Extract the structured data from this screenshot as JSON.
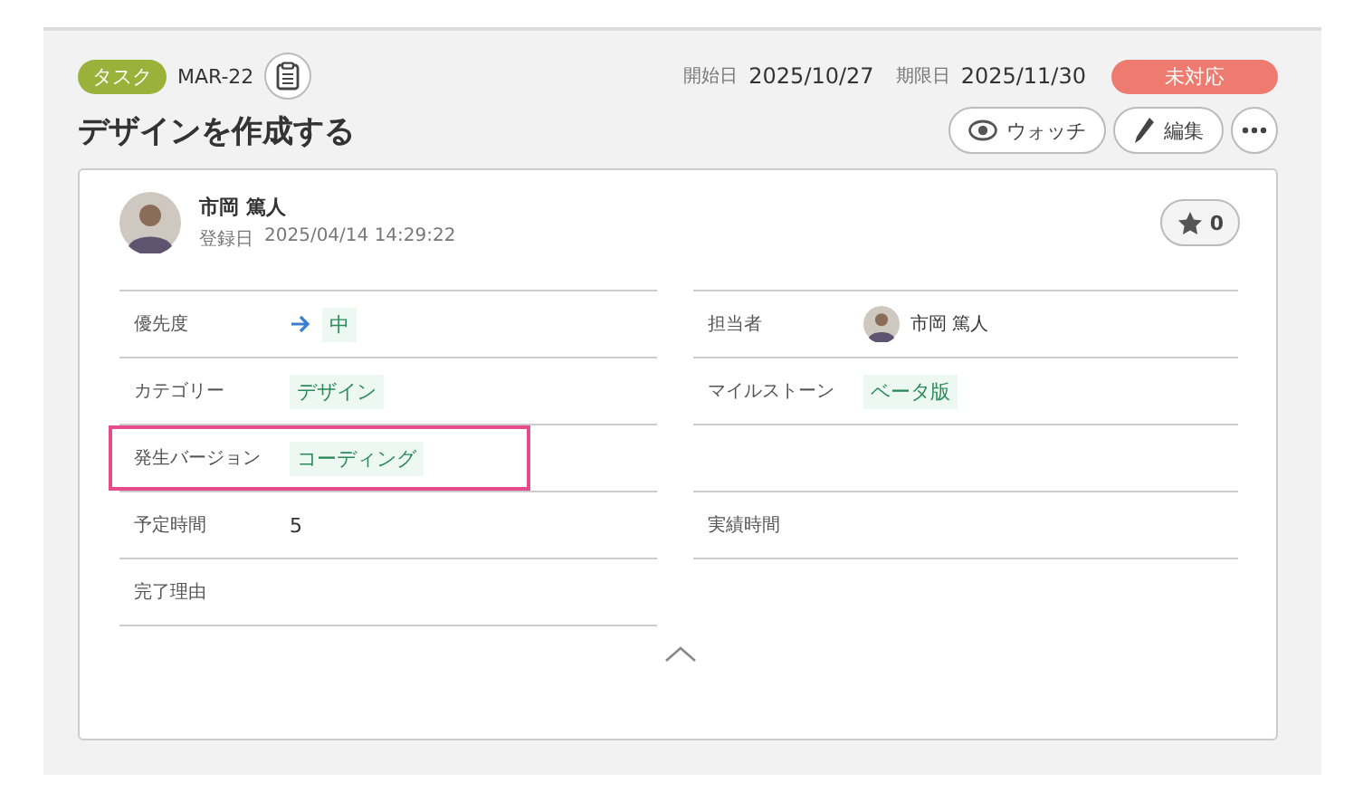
{
  "header": {
    "type_badge": "タスク",
    "key": "MAR-22",
    "start_label": "開始日",
    "start_date": "2025/10/27",
    "due_label": "期限日",
    "due_date": "2025/11/30",
    "status": "未対応",
    "title": "デザインを作成する",
    "buttons": [
      {
        "kind": "watch",
        "label": "ウォッチ"
      },
      {
        "kind": "edit",
        "label": "編集"
      },
      {
        "kind": "more"
      }
    ]
  },
  "author": {
    "name": "市岡 篤人",
    "registered_label": "登録日",
    "registered": "2025/04/14 14:29:22",
    "stars_count": "0"
  },
  "rows": [
    {
      "left": {
        "kind": "priority",
        "label": "優先度",
        "value": "中",
        "highlighted": false
      },
      "right": {
        "kind": "user",
        "label": "担当者",
        "value": "市岡 篤人",
        "highlighted": false
      }
    },
    {
      "left": {
        "kind": "tag",
        "label": "カテゴリー",
        "value": "デザイン",
        "highlighted": false
      },
      "right": {
        "kind": "tag",
        "label": "マイルストーン",
        "value": "ベータ版",
        "highlighted": false
      }
    },
    {
      "left": {
        "kind": "tag",
        "label": "発生バージョン",
        "value": "コーディング",
        "highlighted": true
      },
      "right": {
        "highlighted": false
      }
    },
    {
      "left": {
        "kind": "text",
        "label": "予定時間",
        "value": "5",
        "highlighted": false
      },
      "right": {
        "label": "実績時間",
        "highlighted": false
      }
    },
    {
      "left": {
        "label": "完了理由",
        "highlighted": false
      },
      "right": null
    }
  ]
}
